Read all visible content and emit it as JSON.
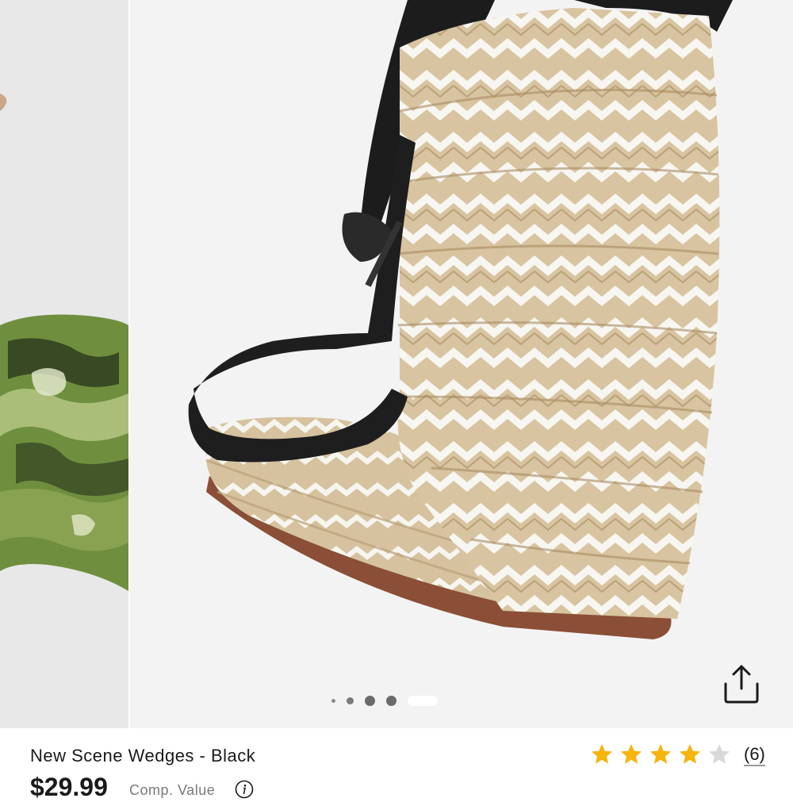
{
  "product": {
    "title": "New Scene Wedges - Black",
    "price": "$29.99",
    "comp_value_label": "Comp. Value"
  },
  "rating": {
    "stars": 4,
    "max_stars": 5,
    "count_label": "(6)"
  },
  "gallery": {
    "image_count": 5,
    "active_index": 4,
    "share_icon": "share-icon"
  },
  "colors": {
    "star_filled": "#F6B40E",
    "star_empty": "#D9D9D9",
    "dot": "#6B6B6B",
    "dot_active": "#FFFFFF"
  }
}
